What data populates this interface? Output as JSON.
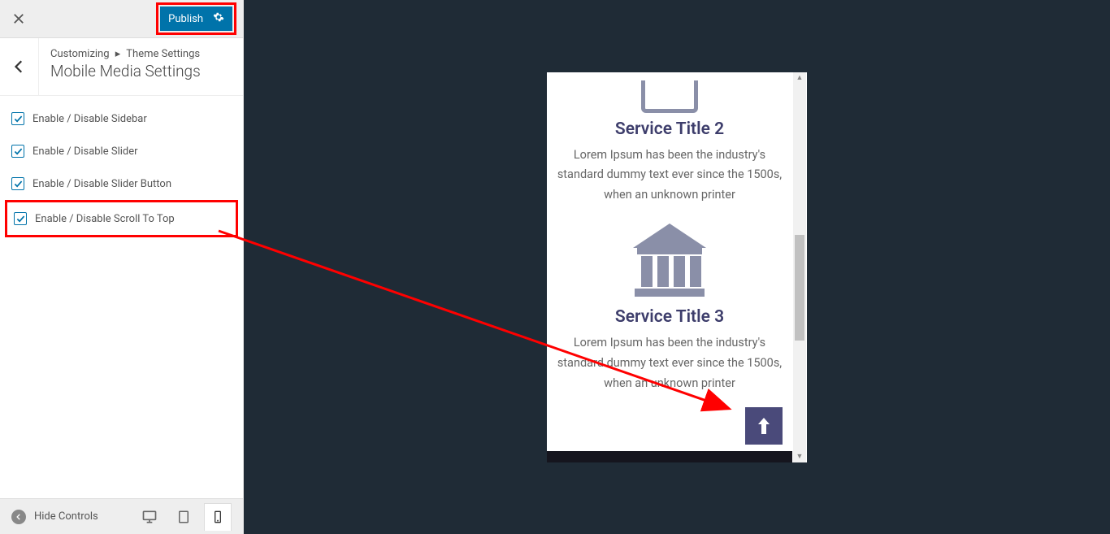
{
  "topbar": {
    "publish_label": "Publish"
  },
  "header": {
    "breadcrumb_root": "Customizing",
    "breadcrumb_current": "Theme Settings",
    "title": "Mobile Media Settings"
  },
  "options": [
    {
      "label": "Enable / Disable Sidebar",
      "checked": true
    },
    {
      "label": "Enable / Disable Slider",
      "checked": true
    },
    {
      "label": "Enable / Disable Slider Button",
      "checked": true
    },
    {
      "label": "Enable / Disable Scroll To Top",
      "checked": true
    }
  ],
  "footer": {
    "hide_controls_label": "Hide Controls"
  },
  "preview": {
    "service2_title": "Service Title 2",
    "service2_text": "Lorem Ipsum has been the industry's standard dummy text ever since the 1500s, when an unknown printer",
    "service3_title": "Service Title 3",
    "service3_text": "Lorem Ipsum has been the industry's standard dummy text ever since the 1500s, when an unknown printer"
  }
}
